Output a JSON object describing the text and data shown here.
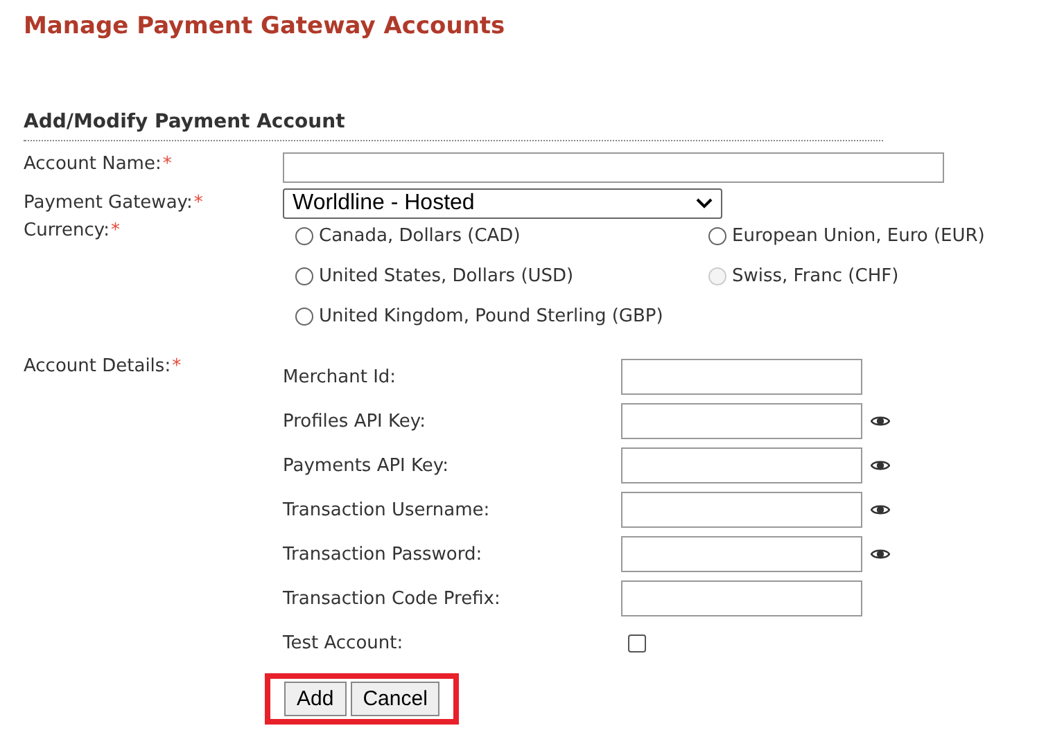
{
  "page_title": "Manage Payment Gateway Accounts",
  "section_title": "Add/Modify Payment Account",
  "account_name": {
    "label": "Account Name:",
    "required_mark": "*"
  },
  "payment_gateway": {
    "label": "Payment Gateway:",
    "required_mark": "*",
    "value": "Worldline - Hosted"
  },
  "currency": {
    "label": "Currency:",
    "required_mark": "*",
    "options": [
      {
        "label": "Canada, Dollars (CAD)",
        "selected": false,
        "disabled": false
      },
      {
        "label": "European Union, Euro (EUR)",
        "selected": false,
        "disabled": false
      },
      {
        "label": "United States, Dollars (USD)",
        "selected": false,
        "disabled": false
      },
      {
        "label": "Swiss, Franc (CHF)",
        "selected": false,
        "disabled": true
      },
      {
        "label": "United Kingdom, Pound Sterling (GBP)",
        "selected": false,
        "disabled": false
      }
    ]
  },
  "account_details": {
    "label": "Account Details:",
    "required_mark": "*",
    "fields": [
      {
        "kind": "text",
        "label": "Merchant Id:"
      },
      {
        "kind": "text",
        "label": "Profiles API Key:",
        "reveal": true
      },
      {
        "kind": "text",
        "label": "Payments API Key:",
        "reveal": true
      },
      {
        "kind": "text",
        "label": "Transaction Username:",
        "reveal": true
      },
      {
        "kind": "text",
        "label": "Transaction Password:",
        "reveal": true
      },
      {
        "kind": "text",
        "label": "Transaction Code Prefix:"
      },
      {
        "kind": "checkbox",
        "label": "Test Account:",
        "checked": false
      }
    ]
  },
  "buttons": {
    "highlighted": true,
    "items": [
      "Add",
      "Cancel"
    ]
  }
}
